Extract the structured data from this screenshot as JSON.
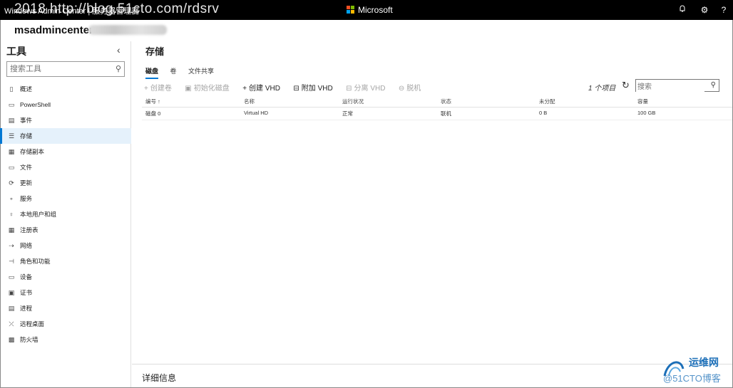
{
  "window": {
    "title": "Windows Admin Center | 服务器管理器",
    "watermark": "2018 http://blog.51cto.com/rdsrv",
    "brand": "Microsoft",
    "brand_colors": [
      "#f25022",
      "#7fba00",
      "#00a4ef",
      "#ffb900"
    ]
  },
  "server": {
    "name": "msadmincenter"
  },
  "sidebar": {
    "title": "工具",
    "collapse_icon": "chevron-left-icon",
    "search_placeholder": "搜索工具",
    "items": [
      {
        "label": "概述",
        "icon": "phone-icon"
      },
      {
        "label": "PowerShell",
        "icon": "powershell-icon"
      },
      {
        "label": "事件",
        "icon": "events-icon"
      },
      {
        "label": "存储",
        "icon": "storage-icon",
        "active": true
      },
      {
        "label": "存储副本",
        "icon": "storage-replica-icon"
      },
      {
        "label": "文件",
        "icon": "folder-icon"
      },
      {
        "label": "更新",
        "icon": "update-icon"
      },
      {
        "label": "服务",
        "icon": "services-icon"
      },
      {
        "label": "本地用户和组",
        "icon": "users-icon"
      },
      {
        "label": "注册表",
        "icon": "registry-icon"
      },
      {
        "label": "网络",
        "icon": "network-icon"
      },
      {
        "label": "角色和功能",
        "icon": "roles-icon"
      },
      {
        "label": "设备",
        "icon": "devices-icon"
      },
      {
        "label": "证书",
        "icon": "certificate-icon"
      },
      {
        "label": "进程",
        "icon": "process-icon"
      },
      {
        "label": "远程桌面",
        "icon": "remote-desktop-icon"
      },
      {
        "label": "防火墙",
        "icon": "firewall-icon"
      }
    ]
  },
  "main": {
    "title": "存储",
    "tabs": [
      {
        "label": "磁盘",
        "active": true
      },
      {
        "label": "卷"
      },
      {
        "label": "文件共享"
      }
    ],
    "toolbar": {
      "create_volume": "创建卷",
      "initialize_disk": "初始化磁盘",
      "create_vhd": "创建 VHD",
      "attach_vhd": "附加 VHD",
      "detach_vhd": "分离 VHD",
      "offline": "脱机"
    },
    "item_count": "1 个项目",
    "search_placeholder": "搜索",
    "table": {
      "headers": [
        "编号 ↑",
        "名称",
        "运行状况",
        "状态",
        "未分配",
        "容量"
      ],
      "rows": [
        [
          "磁盘 0",
          "Virtual HD",
          "正常",
          "联机",
          "0 B",
          "100 GB"
        ]
      ]
    },
    "details_label": "详细信息"
  },
  "corner_watermark": {
    "line1": "运维网",
    "line2": "@51CTO博客"
  },
  "colors": {
    "accent": "#0078d4",
    "topbar": "#000000"
  }
}
